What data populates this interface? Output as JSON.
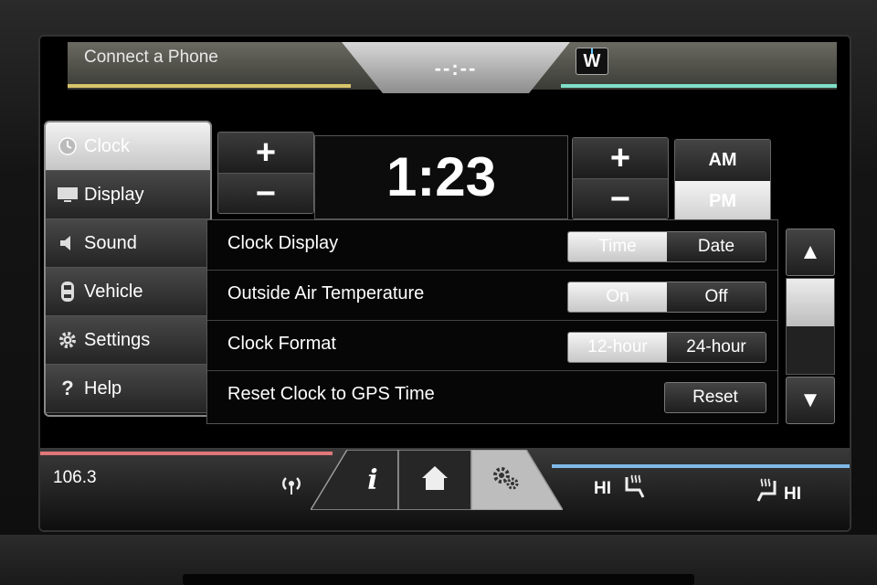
{
  "status_bar": {
    "phone_label": "Connect a Phone",
    "clock_placeholder": "--:--",
    "compass_heading": "W"
  },
  "nav": {
    "items": [
      {
        "label": "Clock",
        "icon": "clock-icon",
        "active": true
      },
      {
        "label": "Display",
        "icon": "display-icon",
        "active": false
      },
      {
        "label": "Sound",
        "icon": "speaker-icon",
        "active": false
      },
      {
        "label": "Vehicle",
        "icon": "car-icon",
        "active": false
      },
      {
        "label": "Settings",
        "icon": "gear-icon",
        "active": false
      },
      {
        "label": "Help",
        "icon": "help-icon",
        "active": false
      }
    ]
  },
  "clock_setter": {
    "hour_plus": "+",
    "hour_minus": "−",
    "time": "1:23",
    "minute_plus": "+",
    "minute_minus": "−",
    "am_label": "AM",
    "pm_label": "PM",
    "selected_meridiem": "PM"
  },
  "settings": {
    "rows": [
      {
        "label": "Clock Display",
        "options": [
          "Time",
          "Date"
        ],
        "selected": "Time"
      },
      {
        "label": "Outside Air Temperature",
        "options": [
          "On",
          "Off"
        ],
        "selected": "On"
      },
      {
        "label": "Clock Format",
        "options": [
          "12-hour",
          "24-hour"
        ],
        "selected": "12-hour"
      },
      {
        "label": "Reset Clock to GPS Time",
        "button": "Reset"
      }
    ]
  },
  "scroll": {
    "up": "▲",
    "down": "▼"
  },
  "bottom_bar": {
    "radio_frequency": "106.3",
    "seat_left": "HI",
    "seat_right": "HI"
  },
  "colors": {
    "top_left_accent": "#d9c36a",
    "top_right_accent": "#7fe0c9",
    "bottom_left_accent": "#e0777a",
    "bottom_right_accent": "#7fb9e8"
  }
}
